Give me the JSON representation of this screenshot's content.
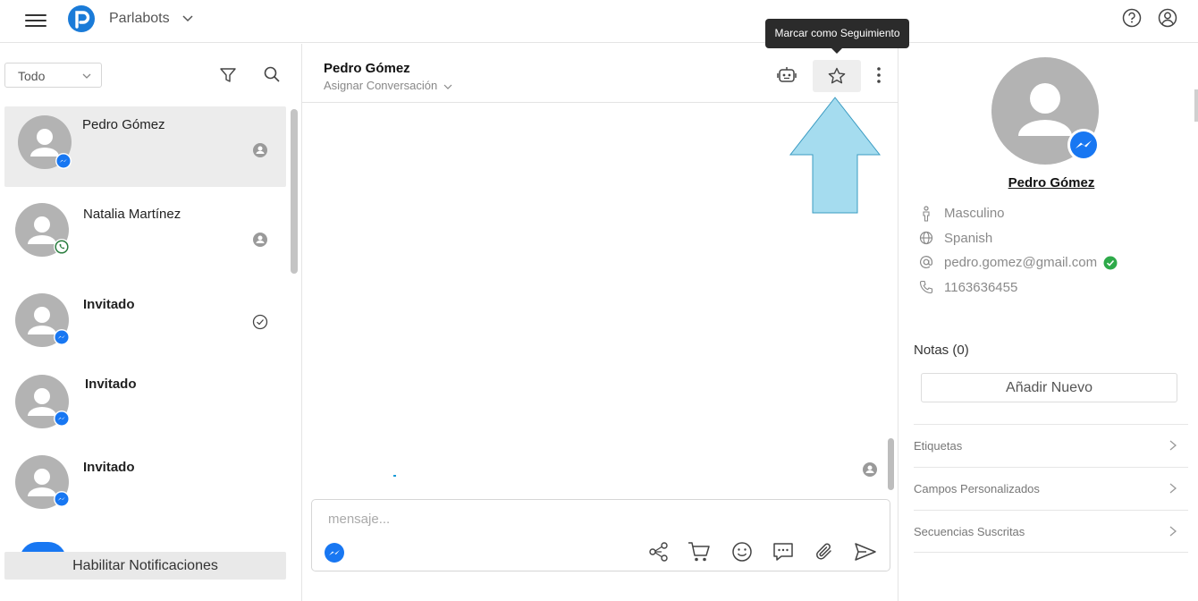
{
  "topbar": {
    "brand": "Parlabots",
    "colors": {
      "brand_blue": "#1a7bd8"
    }
  },
  "left": {
    "filter_value": "Todo",
    "conversations": [
      {
        "name": "Pedro Gómez",
        "channel": "messenger",
        "status": "user-icon",
        "active": true,
        "bold": false
      },
      {
        "name": "Natalia Martínez",
        "channel": "whatsapp",
        "status": "user-icon",
        "active": false,
        "bold": false
      },
      {
        "name": "Invitado",
        "channel": "messenger",
        "status": "check-circle-icon",
        "active": false,
        "bold": true
      },
      {
        "name": "Invitado",
        "channel": "messenger",
        "status": "none",
        "active": false,
        "bold": true
      },
      {
        "name": "Invitado",
        "channel": "messenger",
        "status": "none",
        "active": false,
        "bold": true
      }
    ],
    "notify_button": "Habilitar Notificaciones"
  },
  "chat": {
    "contact_name": "Pedro Gómez",
    "assign_label": "Asignar Conversación",
    "composer_placeholder": "mensaje...",
    "tooltip": "Marcar como Seguimiento"
  },
  "profile": {
    "name": "Pedro Gómez",
    "gender": "Masculino",
    "language": "Spanish",
    "email": "pedro.gomez@gmail.com",
    "phone": "1163636455",
    "notes_title": "Notas (0)",
    "add_new": "Añadir Nuevo",
    "sections": [
      "Etiquetas",
      "Campos Personalizados",
      "Secuencias Suscritas"
    ]
  },
  "colors": {
    "messenger": "#1877f2",
    "whatsapp": "#25d366",
    "verified": "#2eaa4a",
    "annotation_arrow": "#a5dcef"
  }
}
